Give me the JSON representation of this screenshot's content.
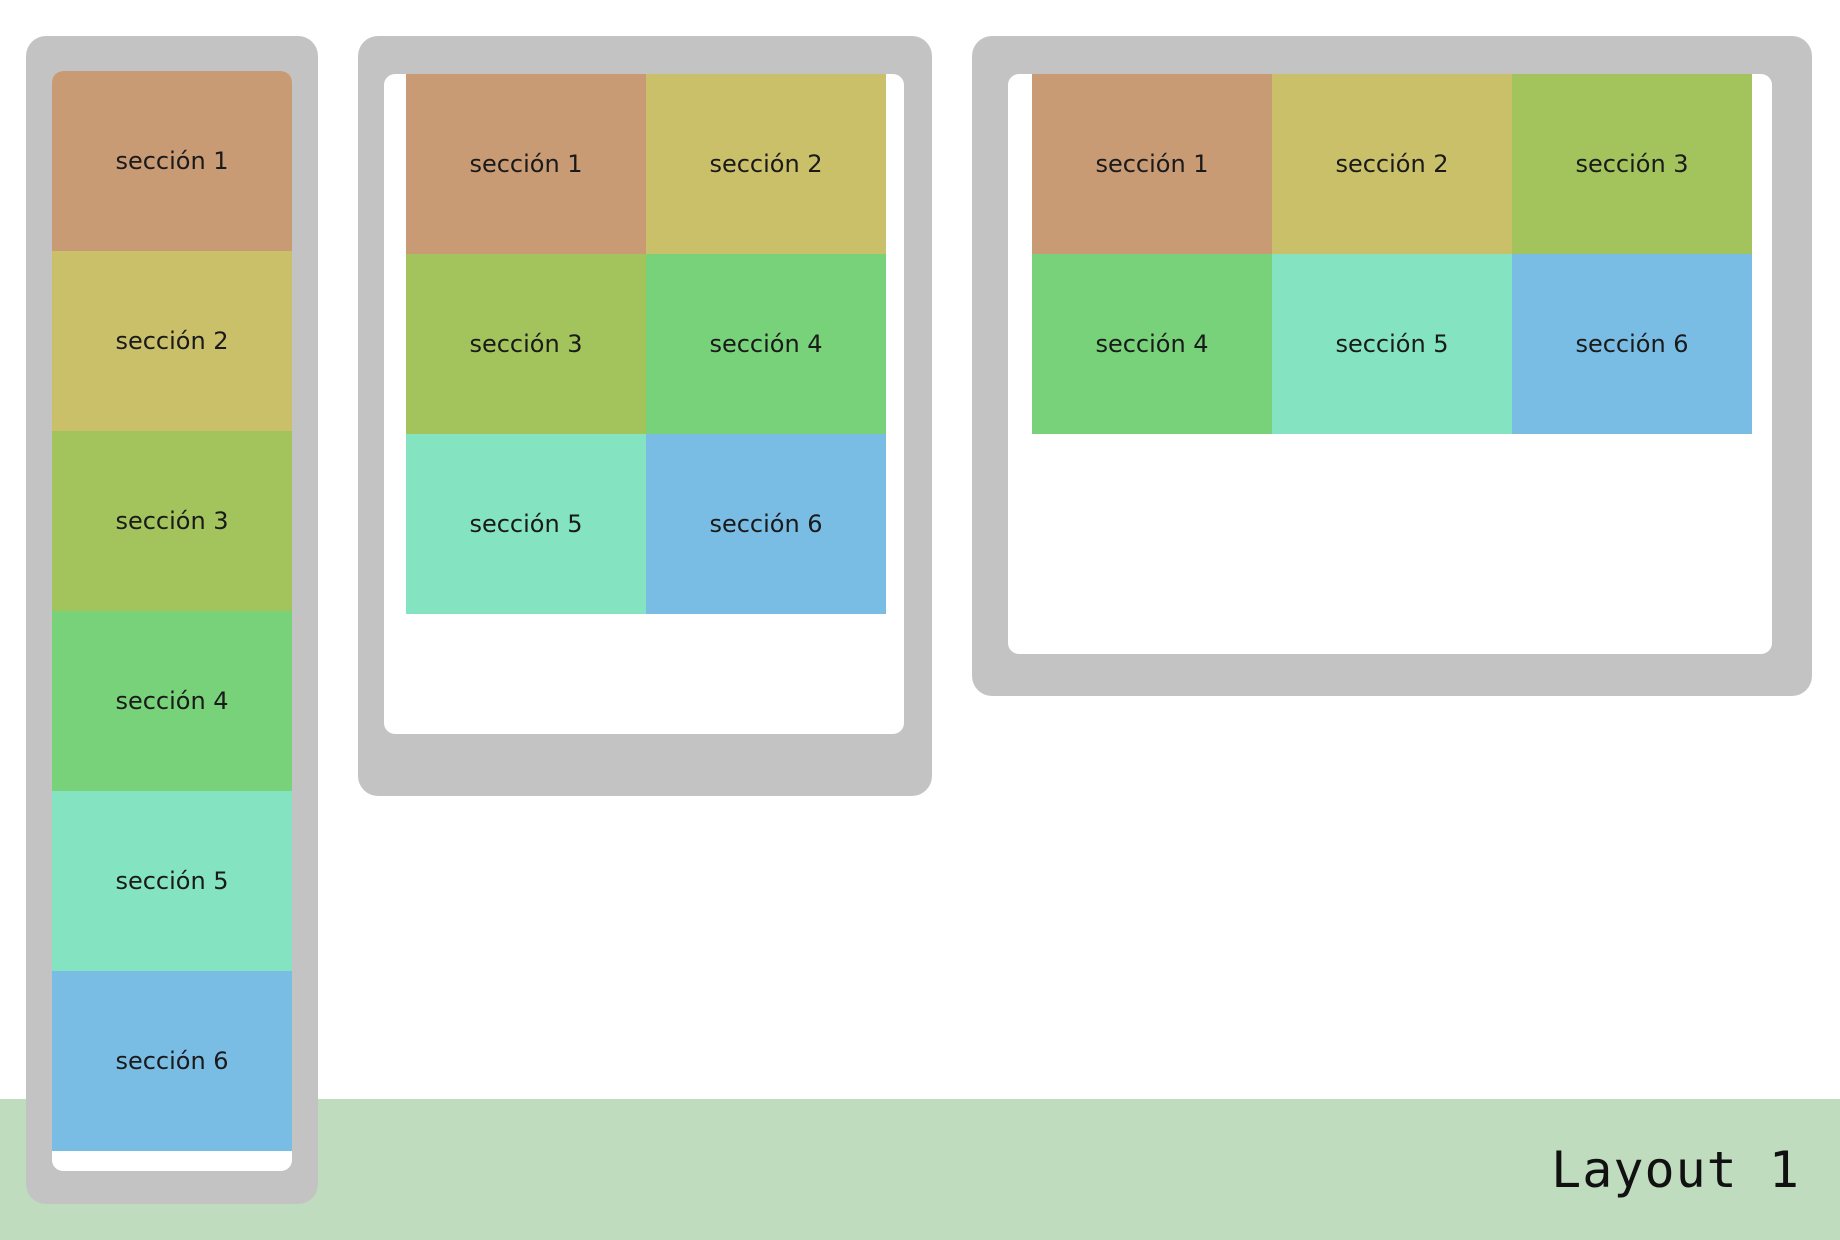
{
  "colors": {
    "device_frame": "#c3c3c3",
    "footer_band": "#bfdcbf",
    "section_1": "#c99b75",
    "section_2": "#cac06a",
    "section_3": "#a3c45c",
    "section_4": "#77d27a",
    "section_5": "#84e4c1",
    "section_6": "#79bde5"
  },
  "sections": [
    {
      "label": "sección 1"
    },
    {
      "label": "sección 2"
    },
    {
      "label": "sección 3"
    },
    {
      "label": "sección 4"
    },
    {
      "label": "sección 5"
    },
    {
      "label": "sección 6"
    }
  ],
  "layouts": {
    "phone": {
      "columns": 1
    },
    "tablet": {
      "columns": 2
    },
    "desktop": {
      "columns": 3
    }
  },
  "footer": {
    "label": "Layout 1"
  }
}
